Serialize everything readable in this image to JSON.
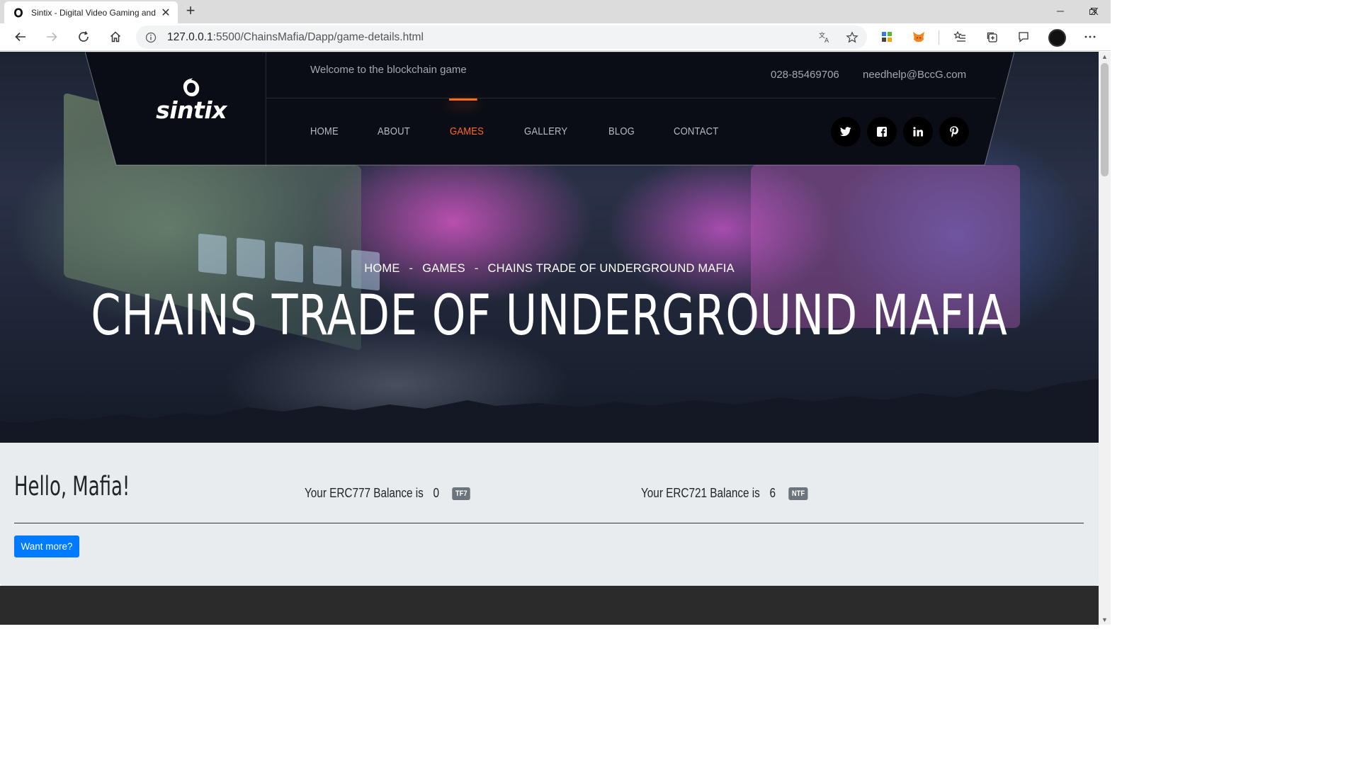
{
  "browser": {
    "tab_title": "Sintix - Digital Video Gaming and",
    "url_host": "127.0.0.1",
    "url_rest": ":5500/ChainsMafia/Dapp/game-details.html"
  },
  "header": {
    "logo_text": "sintix",
    "welcome": "Welcome to the blockchain game",
    "phone": "028-85469706",
    "email": "needhelp@BccG.com",
    "nav": [
      "HOME",
      "ABOUT",
      "GAMES",
      "GALLERY",
      "BLOG",
      "CONTACT"
    ],
    "active_nav": "GAMES",
    "social_icons": [
      "twitter-icon",
      "facebook-icon",
      "linkedin-icon",
      "pinterest-icon"
    ]
  },
  "hero": {
    "breadcrumb": [
      "HOME",
      "GAMES",
      "CHAINS TRADE OF UNDERGROUND MAFIA"
    ],
    "title": "CHAINS TRADE OF UNDERGROUND MAFIA"
  },
  "panel": {
    "greeting": "Hello, Mafia!",
    "erc777_label": "Your ERC777 Balance is",
    "erc777_value": "0",
    "erc777_badge": "TF7",
    "erc721_label": "Your ERC721 Balance is",
    "erc721_value": "6",
    "erc721_badge": "NTF",
    "button_label": "Want more?"
  },
  "colors": {
    "accent": "#ff6b1a",
    "button": "#007bff",
    "header_bg": "#0b0d16",
    "panel_bg": "#e9ecef"
  }
}
